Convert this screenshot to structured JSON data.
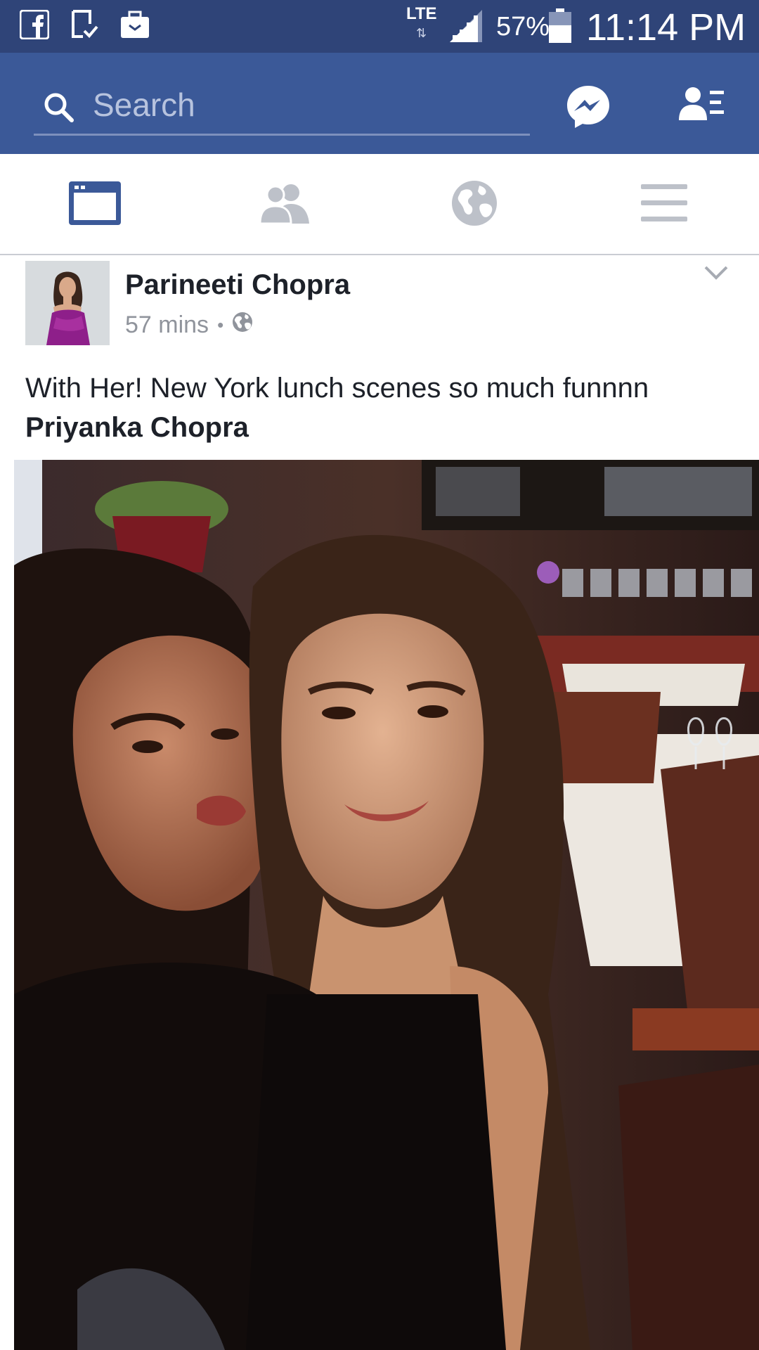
{
  "status_bar": {
    "network": "LTE",
    "battery_percent": "57%",
    "battery_level": 0.57,
    "time": "11:14 PM",
    "left_icons": [
      "facebook-icon",
      "download-check-icon",
      "briefcase-icon"
    ]
  },
  "search": {
    "placeholder": "Search"
  },
  "header_icons": [
    "messenger-icon",
    "friend-requests-icon"
  ],
  "tabs": [
    {
      "name": "news-feed",
      "icon": "news-feed-icon",
      "active": true
    },
    {
      "name": "friends",
      "icon": "friends-icon",
      "active": false
    },
    {
      "name": "notifications",
      "icon": "globe-icon",
      "active": false
    },
    {
      "name": "menu",
      "icon": "menu-icon",
      "active": false
    }
  ],
  "post": {
    "author": "Parineeti Chopra",
    "time": "57 mins",
    "privacy_icon": "globe-icon",
    "text": "With Her! New York lunch scenes so much funnnn",
    "tagged": "Priyanka Chopra"
  },
  "colors": {
    "status_bar": "#2f4478",
    "header": "#3b5998",
    "active_tab": "#3b5998",
    "inactive_tab": "#bdc1c9"
  }
}
